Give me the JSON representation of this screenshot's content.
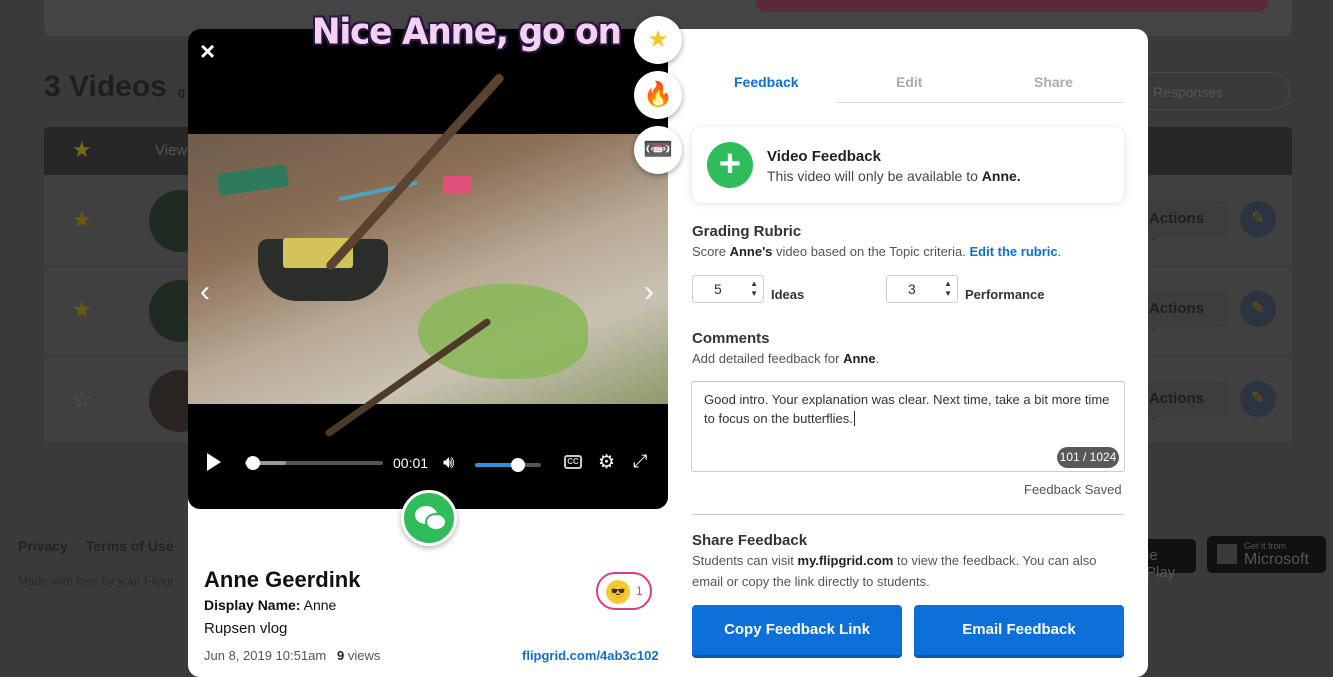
{
  "background": {
    "page_title": "3 Videos",
    "page_sub": "0",
    "search_placeholder": "Responses",
    "header_view": "View",
    "actions_label": "Actions",
    "footer_privacy": "Privacy",
    "footer_terms": "Terms of Use",
    "footer_made": "Made with love by your Flipgr",
    "store_google": "le Play",
    "store_ms_small": "Get it from",
    "store_ms_big": "Microsoft"
  },
  "video": {
    "sticker_text": "Nice Anne, go on",
    "time": "00:01",
    "progress": 0.06,
    "buffered": 0.3,
    "volume": 0.65,
    "cc_label": "CC"
  },
  "reactions": {
    "star": "★",
    "fire": "🔥",
    "sticker": "📼",
    "emoji": "😎",
    "emoji_count": "1"
  },
  "response": {
    "name": "Anne Geerdink",
    "display_name_label": "Display Name:",
    "display_name": "Anne",
    "topic": "Rupsen vlog",
    "date": "Jun 8, 2019 10:51am",
    "views_count": "9",
    "views_label": "views",
    "link": "flipgrid.com/4ab3c102"
  },
  "panel": {
    "tabs": [
      "Feedback",
      "Edit",
      "Share"
    ],
    "video_feedback": {
      "title": "Video Feedback",
      "sub_prefix": "This video will only be available to",
      "sub_name": "Anne."
    },
    "rubric": {
      "heading": "Grading Rubric",
      "desc_prefix": "Score",
      "desc_name": "Anne's",
      "desc_mid": "video based on the Topic criteria.",
      "desc_link": "Edit the rubric",
      "desc_end": ".",
      "criteria": [
        {
          "value": "5",
          "label": "Ideas"
        },
        {
          "value": "3",
          "label": "Performance"
        }
      ]
    },
    "comments": {
      "heading": "Comments",
      "desc_prefix": "Add detailed feedback for",
      "desc_name": "Anne",
      "desc_end": ".",
      "text": "Good intro. Your explanation was clear. Next time, take a bit more time to focus on the butterflies.",
      "counter": "101 / 1024",
      "saved": "Feedback Saved"
    },
    "share": {
      "heading": "Share Feedback",
      "desc_prefix": "Students can visit",
      "desc_site": "my.flipgrid.com",
      "desc_rest": "to view the feedback. You can also email or copy the link directly to students.",
      "copy_button": "Copy Feedback Link",
      "email_button": "Email Feedback"
    }
  },
  "colors": {
    "accent": "#0d6fd8",
    "green": "#2fbd5b",
    "pink": "#e23b7d"
  }
}
